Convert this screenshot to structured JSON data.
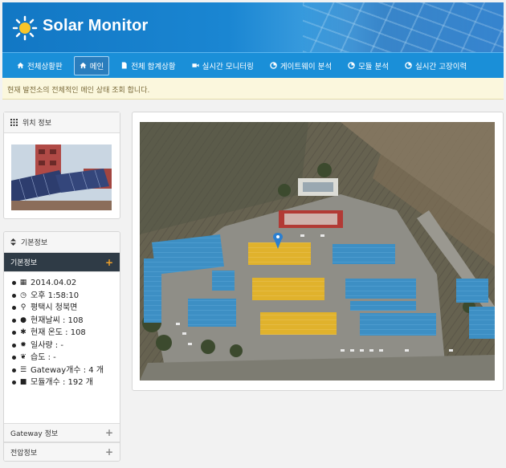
{
  "app": {
    "title": "Solar Monitor"
  },
  "nav": {
    "items": [
      {
        "label": "전체상황판"
      },
      {
        "label": "메인"
      },
      {
        "label": "전체 합계상황"
      },
      {
        "label": "실시간 모니터링"
      },
      {
        "label": "게이트웨이 분석"
      },
      {
        "label": "모듈 분석"
      },
      {
        "label": "실시간 고장이력"
      }
    ]
  },
  "notice": {
    "text": "현재 발전소의 전체적인 메인 상태 조회 합니다."
  },
  "location_panel": {
    "title": "위치 정보"
  },
  "basic_panel": {
    "title": "기본정보",
    "section_label": "기본정보",
    "items": [
      {
        "icon": "calendar-icon",
        "text": "2014.04.02"
      },
      {
        "icon": "clock-icon",
        "text": "오후 1:58:10"
      },
      {
        "icon": "map-marker-icon",
        "text": "평택시 청북면"
      },
      {
        "icon": "comment-icon",
        "text": "현재날씨 : 108"
      },
      {
        "icon": "asterisk-icon",
        "text": "현재 온도 : 108"
      },
      {
        "icon": "sun-icon",
        "text": "일사량 : -"
      },
      {
        "icon": "leaf-icon",
        "text": "습도 : -"
      },
      {
        "icon": "list-icon",
        "text": "Gateway개수 : 4 개"
      },
      {
        "icon": "square-icon",
        "text": "모듈개수 : 192 개"
      }
    ],
    "gateway_label": "Gateway 정보",
    "power_label": "전압정보"
  },
  "colors": {
    "nav_bg": "#1a8fd8",
    "accent_plus": "#f0a12a",
    "roof_yellow": "#e0b22c",
    "roof_blue": "#3d8fc4"
  }
}
